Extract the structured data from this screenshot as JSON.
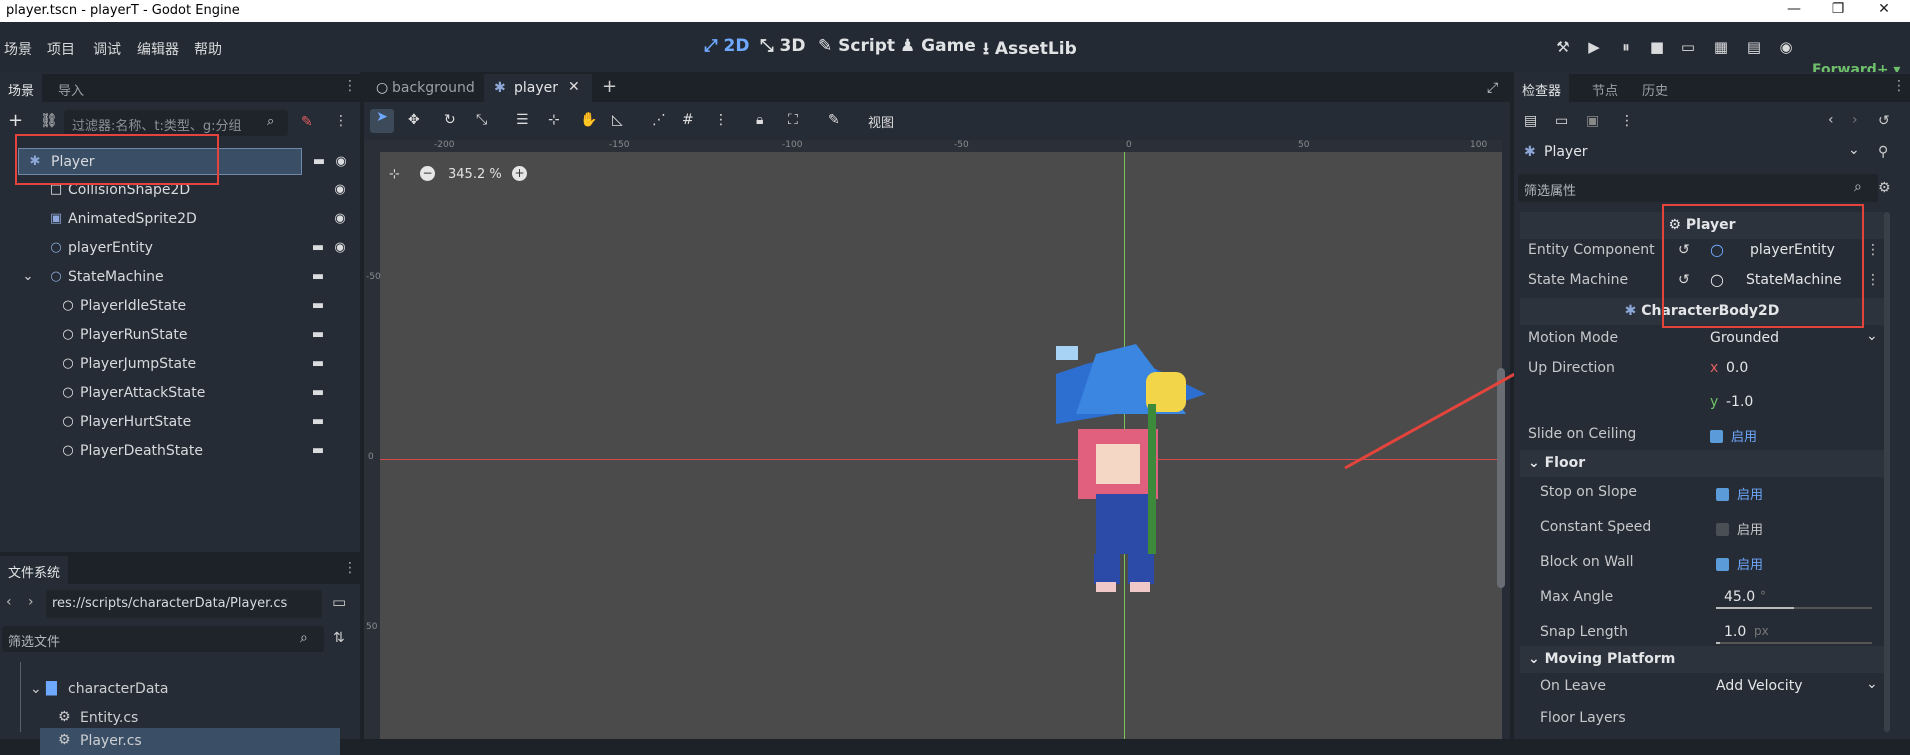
{
  "window": {
    "title": "player.tscn - playerT - Godot Engine",
    "min": "—",
    "max": "❐",
    "close": "✕"
  },
  "menu": [
    "场景",
    "项目",
    "调试",
    "编辑器",
    "帮助"
  ],
  "workspaces": [
    {
      "label": "2D",
      "icon": "⤢"
    },
    {
      "label": "3D",
      "icon": "⤡"
    },
    {
      "label": "Script",
      "icon": "✎"
    },
    {
      "label": "Game",
      "icon": "♟"
    },
    {
      "label": "AssetLib",
      "icon": "⭳"
    }
  ],
  "renderer": "Forward+",
  "scene_panel": {
    "tabs": [
      "场景",
      "导入"
    ],
    "filter_placeholder": "过滤器:名称、t:类型、g:分组",
    "nodes": [
      {
        "name": "Player",
        "indent": 0,
        "script": true,
        "eye": true,
        "icon": "✱",
        "selected": true
      },
      {
        "name": "CollisionShape2D",
        "indent": 1,
        "script": false,
        "eye": true,
        "icon": "□"
      },
      {
        "name": "AnimatedSprite2D",
        "indent": 1,
        "script": false,
        "eye": true,
        "icon": "▣"
      },
      {
        "name": "playerEntity",
        "indent": 1,
        "script": true,
        "eye": true,
        "icon": "○"
      },
      {
        "name": "StateMachine",
        "indent": 1,
        "script": true,
        "eye": false,
        "icon": "○",
        "expand": true
      },
      {
        "name": "PlayerIdleState",
        "indent": 2,
        "script": true,
        "eye": false,
        "icon": "○"
      },
      {
        "name": "PlayerRunState",
        "indent": 2,
        "script": true,
        "eye": false,
        "icon": "○"
      },
      {
        "name": "PlayerJumpState",
        "indent": 2,
        "script": true,
        "eye": false,
        "icon": "○"
      },
      {
        "name": "PlayerAttackState",
        "indent": 2,
        "script": true,
        "eye": false,
        "icon": "○"
      },
      {
        "name": "PlayerHurtState",
        "indent": 2,
        "script": true,
        "eye": false,
        "icon": "○"
      },
      {
        "name": "PlayerDeathState",
        "indent": 2,
        "script": true,
        "eye": false,
        "icon": "○"
      }
    ]
  },
  "filesystem": {
    "tab": "文件系统",
    "path": "res://scripts/characterData/Player.cs",
    "filter_placeholder": "筛选文件",
    "items": [
      {
        "name": "characterData",
        "type": "folder"
      },
      {
        "name": "Entity.cs",
        "type": "file"
      },
      {
        "name": "Player.cs",
        "type": "file"
      }
    ]
  },
  "editor_tabs": [
    {
      "label": "background",
      "active": false
    },
    {
      "label": "player",
      "active": true
    }
  ],
  "editor_toolbar": {
    "view_label": "视图"
  },
  "viewport": {
    "zoom": "345.2 %",
    "ruler_top": [
      "-200",
      "-150",
      "-100",
      "-50",
      "0",
      "50",
      "100"
    ],
    "ruler_left": [
      "-50",
      "0",
      "50"
    ]
  },
  "inspector": {
    "tabs": [
      "检查器",
      "节点",
      "历史"
    ],
    "object": "Player",
    "filter_placeholder": "筛选属性",
    "player_section": "Player",
    "exports": [
      {
        "key": "Entity Component",
        "value": "playerEntity"
      },
      {
        "key": "State Machine",
        "value": "StateMachine"
      }
    ],
    "body_section": "CharacterBody2D",
    "motion_mode": {
      "key": "Motion Mode",
      "value": "Grounded"
    },
    "up_direction": {
      "key": "Up Direction",
      "x": "0.0",
      "y": "-1.0"
    },
    "slide_on_ceiling": {
      "key": "Slide on Ceiling",
      "value": "启用"
    },
    "floor_section": "Floor",
    "floor": [
      {
        "key": "Stop on Slope",
        "value": "启用",
        "on": true
      },
      {
        "key": "Constant Speed",
        "value": "启用",
        "on": false
      },
      {
        "key": "Block on Wall",
        "value": "启用",
        "on": true
      }
    ],
    "max_angle": {
      "key": "Max Angle",
      "value": "45.0",
      "unit": "°",
      "fraction": 0.5
    },
    "snap_length": {
      "key": "Snap Length",
      "value": "1.0",
      "unit": "px",
      "fraction": 0.02
    },
    "moving_platform_section": "Moving Platform",
    "on_leave": {
      "key": "On Leave",
      "value": "Add Velocity"
    },
    "floor_layers": {
      "key": "Floor Layers"
    }
  },
  "colors": {
    "accent": "#6fa9ff",
    "annotation": "#e5443c",
    "renderer": "#6fc06b"
  }
}
